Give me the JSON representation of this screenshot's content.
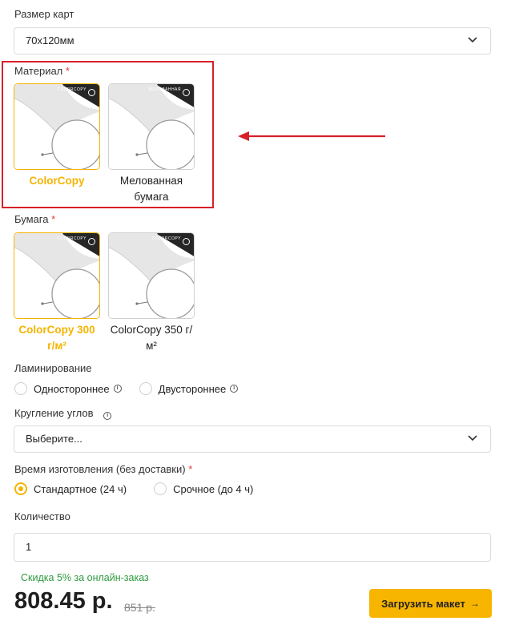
{
  "card_size": {
    "label": "Размер карт",
    "value": "70x120мм"
  },
  "material": {
    "label": "Материал",
    "required_mark": "*",
    "options": [
      {
        "caption": "ColorCopy",
        "thumb_text": "COLORCOPY",
        "selected": true
      },
      {
        "caption": "Мелованная бумага",
        "thumb_text": "МЕЛОВАННАЯ",
        "selected": false
      }
    ]
  },
  "paper": {
    "label": "Бумага",
    "required_mark": "*",
    "options": [
      {
        "caption": "ColorCopy 300 г/м²",
        "thumb_text": "COLORCOPY",
        "selected": true
      },
      {
        "caption": "ColorCopy 350 г/м²",
        "thumb_text": "COLORCOPY",
        "selected": false
      }
    ]
  },
  "lamination": {
    "label": "Ламинирование",
    "options": [
      {
        "label": "Одностороннее",
        "checked": false
      },
      {
        "label": "Двустороннее",
        "checked": false
      }
    ]
  },
  "corner_rounding": {
    "label": "Кругление углов",
    "placeholder": "Выберите..."
  },
  "production_time": {
    "label": "Время изготовления (без доставки)",
    "required_mark": "*",
    "options": [
      {
        "label": "Стандартное (24 ч)",
        "checked": true
      },
      {
        "label": "Срочное (до 4 ч)",
        "checked": false
      }
    ]
  },
  "quantity": {
    "label": "Количество",
    "value": "1"
  },
  "discount_text": "Скидка 5% за онлайн-заказ",
  "price": {
    "current": "808.45 р.",
    "old": "851 р."
  },
  "upload_button": {
    "label": "Загрузить макет",
    "arrow": "→"
  },
  "colors": {
    "accent": "#f5b400",
    "annotation": "#d8202a",
    "discount": "#2e9a3e"
  }
}
